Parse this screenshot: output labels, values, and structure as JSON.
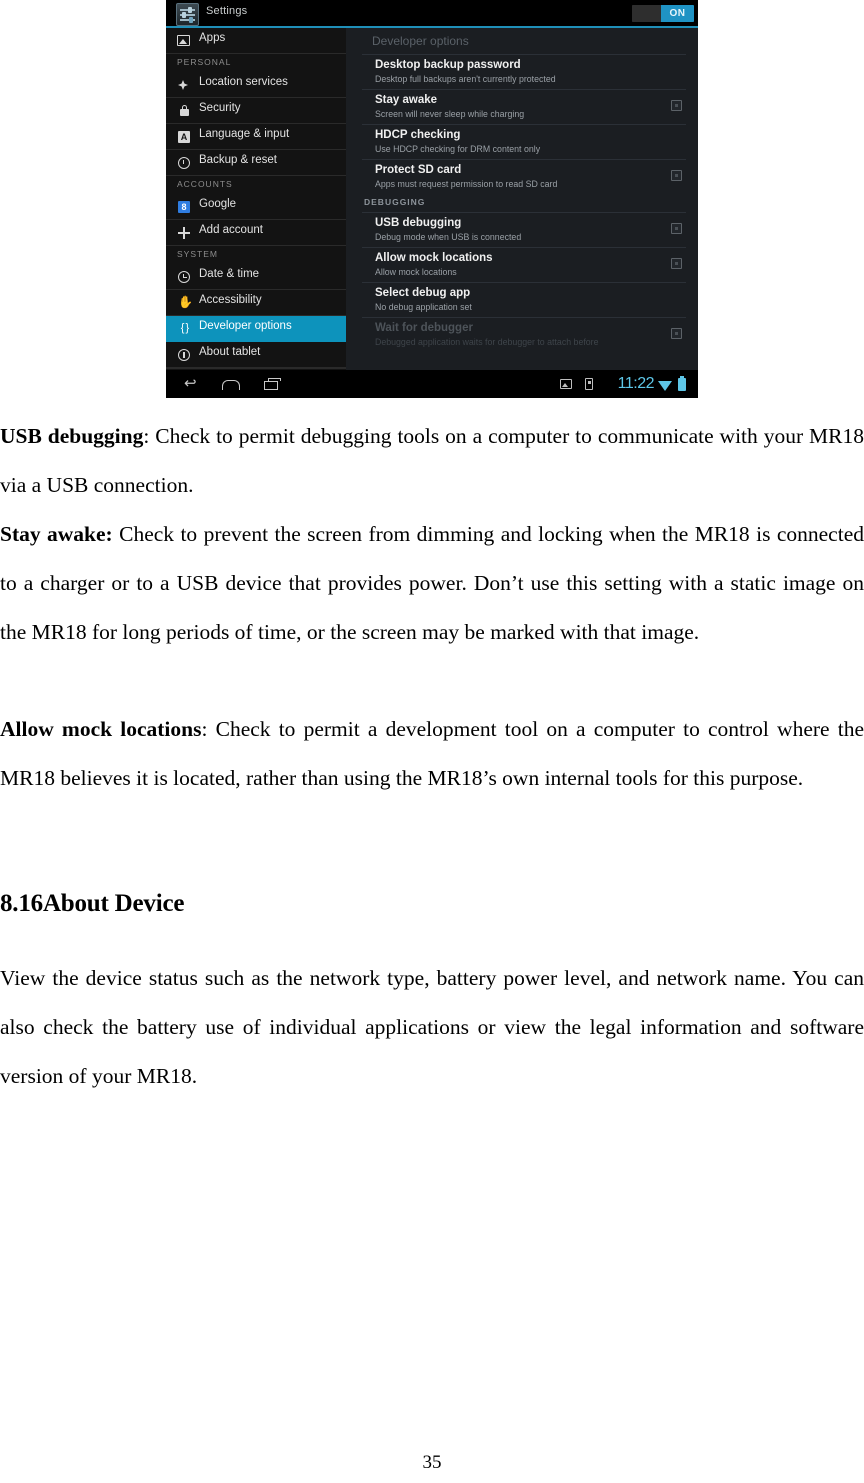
{
  "figure": {
    "app_title": "Settings",
    "app_icon": "settings-sliders-icon",
    "toggle_label": "ON",
    "sidebar": [
      {
        "type": "item",
        "label": "Apps",
        "icon": "apps-icon",
        "selected": false
      },
      {
        "type": "header",
        "label": "PERSONAL"
      },
      {
        "type": "item",
        "label": "Location services",
        "icon": "location-icon",
        "selected": false
      },
      {
        "type": "item",
        "label": "Security",
        "icon": "lock-icon",
        "selected": false
      },
      {
        "type": "item",
        "label": "Language & input",
        "icon": "language-icon",
        "selected": false
      },
      {
        "type": "item",
        "label": "Backup & reset",
        "icon": "backup-reset-icon",
        "selected": false
      },
      {
        "type": "header",
        "label": "ACCOUNTS"
      },
      {
        "type": "item",
        "label": "Google",
        "icon": "google-icon",
        "selected": false
      },
      {
        "type": "item",
        "label": "Add account",
        "icon": "plus-icon",
        "selected": false
      },
      {
        "type": "header",
        "label": "SYSTEM"
      },
      {
        "type": "item",
        "label": "Date & time",
        "icon": "clock-icon",
        "selected": false
      },
      {
        "type": "item",
        "label": "Accessibility",
        "icon": "accessibility-hand-icon",
        "selected": false
      },
      {
        "type": "item",
        "label": "Developer options",
        "icon": "developer-braces-icon",
        "selected": true
      },
      {
        "type": "item",
        "label": "About tablet",
        "icon": "info-icon",
        "selected": false
      }
    ],
    "content_title": "Developer options",
    "options": [
      {
        "title": "Desktop backup password",
        "sub": "Desktop full backups aren't currently protected",
        "checkbox": false,
        "dim": false
      },
      {
        "title": "Stay awake",
        "sub": "Screen will never sleep while charging",
        "checkbox": true,
        "dim": false
      },
      {
        "title": "HDCP checking",
        "sub": "Use HDCP checking for DRM content only",
        "checkbox": false,
        "dim": false
      },
      {
        "title": "Protect SD card",
        "sub": "Apps must request permission to read SD card",
        "checkbox": true,
        "dim": false
      },
      {
        "section": "DEBUGGING"
      },
      {
        "title": "USB debugging",
        "sub": "Debug mode when USB is connected",
        "checkbox": true,
        "dim": false
      },
      {
        "title": "Allow mock locations",
        "sub": "Allow mock locations",
        "checkbox": true,
        "dim": false
      },
      {
        "title": "Select debug app",
        "sub": "No debug application set",
        "checkbox": false,
        "dim": false
      },
      {
        "title": "Wait for debugger",
        "sub": "Debugged application waits for debugger to attach before",
        "checkbox": true,
        "dim": true
      }
    ],
    "navbar": {
      "back_icon": "back-arrow-icon",
      "home_icon": "home-icon",
      "recents_icon": "recent-apps-icon",
      "screenshot_icon": "image-icon",
      "usb_icon": "usb-storage-icon",
      "time": "11:22",
      "wifi_icon": "wifi-icon",
      "battery_icon": "battery-icon"
    },
    "colors": {
      "accent": "#0d93bc",
      "toggle_on": "#1f93c4",
      "status_text": "#5ec7e8"
    }
  },
  "document": {
    "paragraph_1": {
      "term": "USB debugging",
      "text": ": Check to permit debugging tools on a computer to communicate with your MR18 via a USB connection."
    },
    "paragraph_2": {
      "term": "Stay awake:",
      "text": " Check to prevent the screen from dimming and locking when the MR18 is connected to a charger or to a USB device that provides power. Don’t use this setting with a static image on the MR18 for long periods of time, or the screen may be marked with that image."
    },
    "paragraph_3": {
      "term": "Allow mock locations",
      "text": ": Check to permit a development tool on a computer to control where the MR18 believes it is located, rather than using the MR18’s own internal tools for this purpose."
    },
    "heading": "8.16About Device",
    "paragraph_4": "View the device status such as the network type, battery power level, and network name. You can also check the battery use of individual applications or view the legal information and software version of your MR18.",
    "page_number": "35"
  }
}
